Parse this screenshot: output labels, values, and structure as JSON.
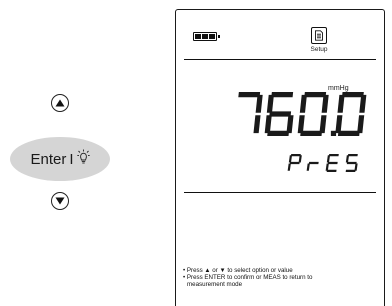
{
  "keys": {
    "up_icon": "up-triangle-icon",
    "down_icon": "down-triangle-icon",
    "enter_label": "Enter",
    "enter_separator": "I",
    "lamp_icon": "backlight-lamp-icon"
  },
  "screen": {
    "battery_icon": "battery-full-icon",
    "setup_icon": "document-icon",
    "setup_label": "Setup",
    "unit": "mmHg",
    "reading": "760.0",
    "parameter": "PrES",
    "instructions": {
      "line1": "• Press ▲ or ▼ to select option or value",
      "line2": "• Press ENTER to confirm or MEAS to return to",
      "line3": "measurement mode"
    }
  },
  "colors": {
    "lcd_ink": "#1a1a1a",
    "enter_key_fill": "#d5d5d5",
    "background": "#ffffff"
  }
}
